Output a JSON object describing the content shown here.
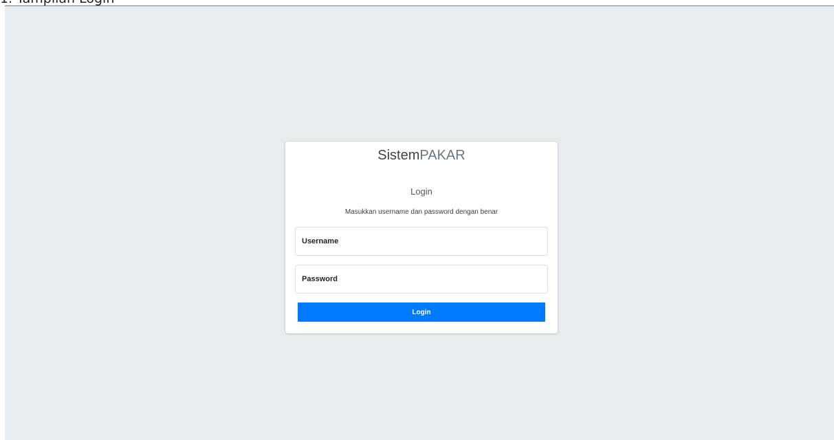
{
  "document": {
    "caption": "1. Tampilan Login"
  },
  "brand": {
    "strong": "Sistem",
    "light": "PAKAR"
  },
  "login": {
    "title": "Login",
    "subtitle": "Masukkan username dan password dengan benar",
    "username": {
      "placeholder": "Username",
      "value": ""
    },
    "password": {
      "placeholder": "Password",
      "value": ""
    },
    "submit_label": "Login"
  },
  "colors": {
    "page_background": "#e9ecef",
    "card_background": "#ffffff",
    "primary": "#007bff",
    "text": "#212529"
  }
}
